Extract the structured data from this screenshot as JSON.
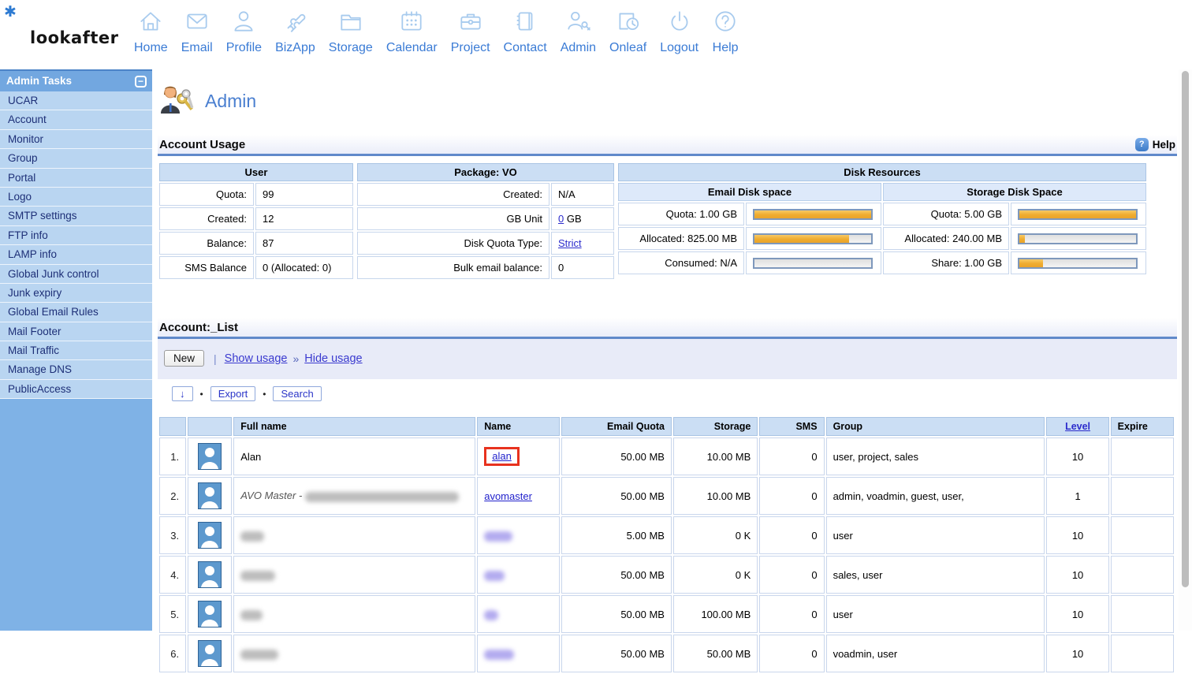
{
  "colors": {
    "accent_blue": "#3A7BD5",
    "sidebar_header": "#72A7E0",
    "sidebar_item_bg": "#B9D5F1",
    "sidebar_item_text": "#1D2F77",
    "link_blue": "#2B2BCC",
    "bar_orange": "#EFAC2F",
    "highlight_red": "#E8321E",
    "table_header_bg": "#CBDEF4"
  },
  "logo": {
    "text": "lookafter",
    "star": "✱"
  },
  "nav": {
    "items": [
      {
        "label": "Home",
        "icon": "home-icon"
      },
      {
        "label": "Email",
        "icon": "email-icon"
      },
      {
        "label": "Profile",
        "icon": "profile-icon"
      },
      {
        "label": "BizApp",
        "icon": "puzzle-icon"
      },
      {
        "label": "Storage",
        "icon": "folder-icon"
      },
      {
        "label": "Calendar",
        "icon": "calendar-icon"
      },
      {
        "label": "Project",
        "icon": "briefcase-icon"
      },
      {
        "label": "Contact",
        "icon": "address-book-icon"
      },
      {
        "label": "Admin",
        "icon": "admin-key-icon"
      },
      {
        "label": "Onleaf",
        "icon": "clock-doc-icon"
      },
      {
        "label": "Logout",
        "icon": "power-icon"
      },
      {
        "label": "Help",
        "icon": "question-icon"
      }
    ]
  },
  "sidebar": {
    "title": "Admin Tasks",
    "collapse_glyph": "−",
    "items": [
      "UCAR",
      "Account",
      "Monitor",
      "Group",
      "Portal",
      "Logo",
      "SMTP settings",
      "FTP info",
      "LAMP info",
      "Global Junk control",
      "Junk expiry",
      "Global Email Rules",
      "Mail Footer",
      "Mail Traffic",
      "Manage DNS",
      "PublicAccess"
    ]
  },
  "page": {
    "title": "Admin"
  },
  "account_usage": {
    "section_title": "Account Usage",
    "help_label": "Help",
    "help_glyph": "?",
    "user": {
      "header": "User",
      "rows": [
        {
          "label": "Quota:",
          "value": "99"
        },
        {
          "label": "Created:",
          "value": "12"
        },
        {
          "label": "Balance:",
          "value": "87"
        },
        {
          "label": "SMS Balance",
          "value": "0 (Allocated: 0)"
        }
      ]
    },
    "package": {
      "header": "Package: VO",
      "rows": [
        {
          "label": "Created:",
          "value": "N/A"
        },
        {
          "label": "GB Unit",
          "link": "0",
          "suffix": " GB"
        },
        {
          "label": "Disk Quota Type:",
          "link": "Strict"
        },
        {
          "label": "Bulk email balance:",
          "value": "0"
        }
      ]
    },
    "disk": {
      "header": "Disk Resources",
      "email": {
        "header": "Email Disk space",
        "rows": [
          {
            "label": "Quota: 1.00 GB",
            "pct": 100,
            "fill": "width:100%"
          },
          {
            "label": "Allocated: 825.00 MB",
            "pct": 81,
            "fill": "width:81%"
          },
          {
            "label": "Consumed: N/A",
            "pct": 0,
            "fill": "width:0%"
          }
        ]
      },
      "storage": {
        "header": "Storage Disk Space",
        "rows": [
          {
            "label": "Quota: 5.00 GB",
            "pct": 100,
            "fill": "width:100%"
          },
          {
            "label": "Allocated: 240.00 MB",
            "pct": 5,
            "fill": "width:5%"
          },
          {
            "label": "Share: 1.00 GB",
            "pct": 20,
            "fill": "width:20%"
          }
        ]
      }
    }
  },
  "account_list": {
    "section_title": "Account:_List",
    "toolbar": {
      "new_label": "New",
      "pipe": "|",
      "show_usage": "Show usage",
      "raquo": "»",
      "hide_usage": "Hide usage",
      "sort_glyph": "↓",
      "dot": "•",
      "export_label": "Export",
      "search_label": "Search"
    },
    "table": {
      "headers": {
        "full_name": "Full name",
        "name": "Name",
        "email_quota": "Email Quota",
        "storage": "Storage",
        "sms": "SMS",
        "group": "Group",
        "level": "Level",
        "expire": "Expire"
      },
      "rows": [
        {
          "num": "1.",
          "full_name": "Alan",
          "name": "alan",
          "email_quota": "50.00 MB",
          "storage": "10.00 MB",
          "sms": "0",
          "group": "user, project, sales",
          "level": "10",
          "expire": ""
        },
        {
          "num": "2.",
          "full_name": "AVO Master -",
          "name": "avomaster",
          "email_quota": "50.00 MB",
          "storage": "10.00 MB",
          "sms": "0",
          "group": "admin, voadmin, guest, user,",
          "level": "1",
          "expire": ""
        },
        {
          "num": "3.",
          "full_name": "",
          "name": "",
          "email_quota": "5.00 MB",
          "storage": "0 K",
          "sms": "0",
          "group": "user",
          "level": "10",
          "expire": ""
        },
        {
          "num": "4.",
          "full_name": "",
          "name": "",
          "email_quota": "50.00 MB",
          "storage": "0 K",
          "sms": "0",
          "group": "sales, user",
          "level": "10",
          "expire": ""
        },
        {
          "num": "5.",
          "full_name": "",
          "name": "",
          "email_quota": "50.00 MB",
          "storage": "100.00 MB",
          "sms": "0",
          "group": "user",
          "level": "10",
          "expire": ""
        },
        {
          "num": "6.",
          "full_name": "",
          "name": "",
          "email_quota": "50.00 MB",
          "storage": "50.00 MB",
          "sms": "0",
          "group": "voadmin, user",
          "level": "10",
          "expire": ""
        }
      ]
    }
  }
}
